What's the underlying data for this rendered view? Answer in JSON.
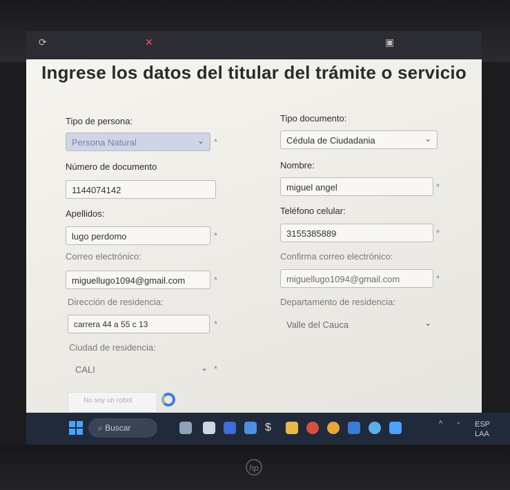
{
  "page": {
    "title": "Ingrese los datos del titular del trámite o servicio"
  },
  "form": {
    "tipo_persona": {
      "label": "Tipo de persona:",
      "value": "Persona Natural"
    },
    "tipo_documento": {
      "label": "Tipo documento:",
      "value": "Cédula de Ciudadania"
    },
    "numero_documento": {
      "label": "Número de documento",
      "value": "1144074142"
    },
    "nombre": {
      "label": "Nombre:",
      "value": "miguel angel"
    },
    "apellidos": {
      "label": "Apellidos:",
      "value": "lugo perdomo"
    },
    "telefono": {
      "label": "Teléfono celular:",
      "value": "3155385889"
    },
    "correo": {
      "label": "Correo electrónico:",
      "value": "miguellugo1094@gmail.com"
    },
    "confirma_correo": {
      "label": "Confirma correo electrónico:",
      "value": "miguellugo1094@gmail.com"
    },
    "direccion": {
      "label": "Dirección de residencia:",
      "value": "carrera 44 a 55 c 13"
    },
    "departamento": {
      "label": "Departamento de residencia:",
      "value": "Valle del Cauca"
    },
    "ciudad": {
      "label": "Ciudad de residencia:",
      "value": "CALI"
    },
    "required_mark": "*"
  },
  "captcha": {
    "label": "No soy un robot"
  },
  "taskbar": {
    "search_placeholder": "Buscar",
    "lang_line1": "ESP",
    "lang_line2": "LAA"
  },
  "colors": {
    "accent": "#3b7ee0",
    "taskbar": "#202a3a"
  }
}
